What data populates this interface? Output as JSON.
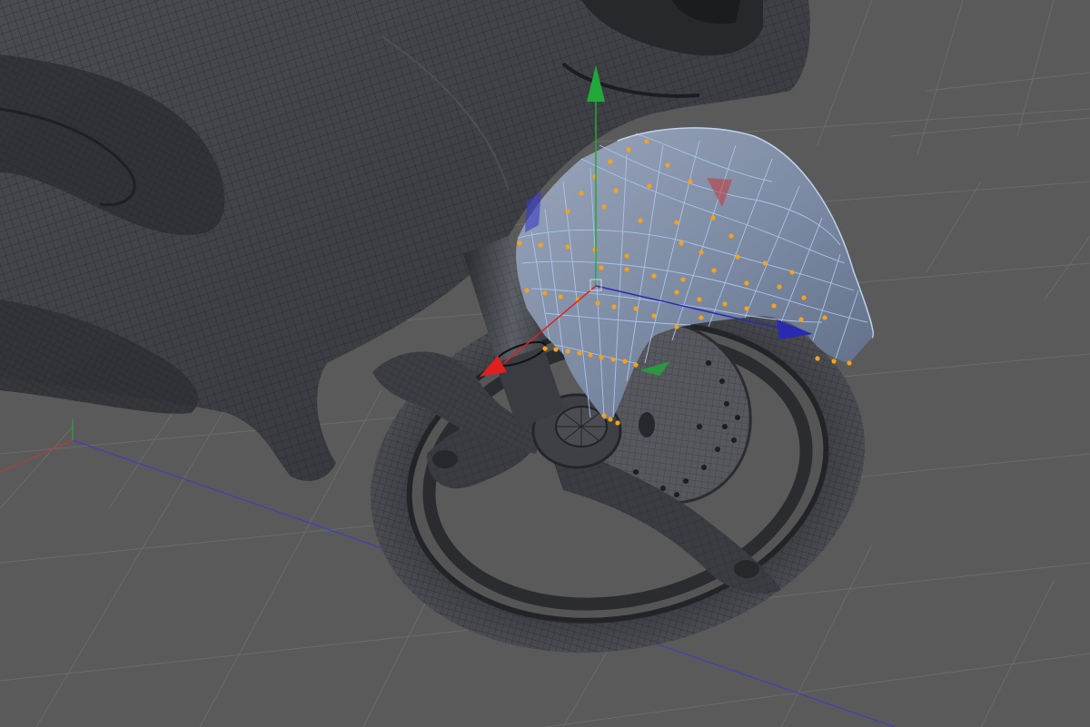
{
  "viewport": {
    "background": "#5a5a5a",
    "grid_line": "#6b6b6b",
    "mesh_fill": "#3d3f44",
    "mesh_wire": "#23252a",
    "selected_fill": "#7f8ea8",
    "selected_wire": "#a9c4ea",
    "point_color": "#f3a21b",
    "world_axis_x": "#c03838",
    "world_axis_y": "#34a734",
    "world_axis_z": "#3b3bcc"
  },
  "gizmo": {
    "x_axis": {
      "color": "#e02020",
      "icon": "x-axis-arrow-icon"
    },
    "y_axis": {
      "color": "#22a83a",
      "icon": "y-axis-arrow-icon"
    },
    "z_axis": {
      "color": "#2a2ab0",
      "icon": "z-axis-arrow-icon"
    }
  },
  "scene": {
    "objects": [
      "motorcycle-body",
      "front-fork",
      "front-wheel",
      "brake-disc",
      "front-fender"
    ],
    "selected_object": "front-fender",
    "mode": "point"
  }
}
